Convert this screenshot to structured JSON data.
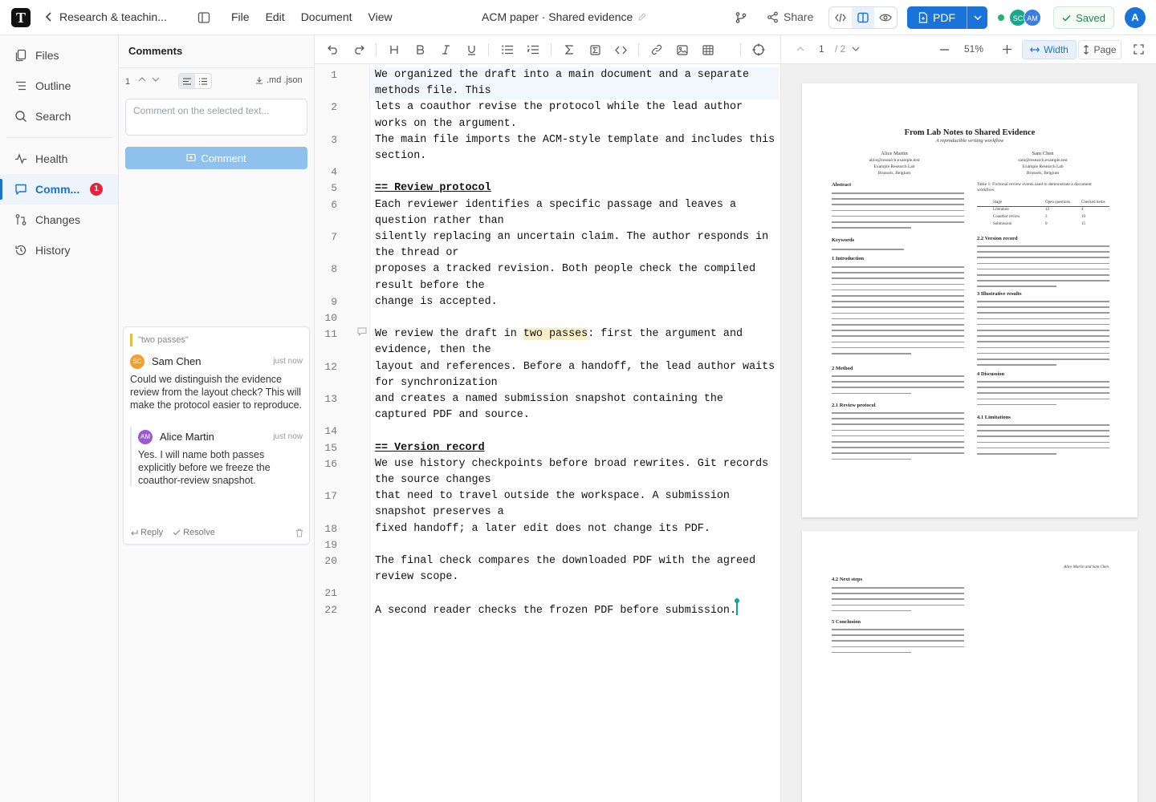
{
  "topbar": {
    "logo": "T",
    "project": "Research & teachin...",
    "menu": [
      "File",
      "Edit",
      "Document",
      "View"
    ],
    "doc_title": "ACM paper · Shared evidence",
    "share": "Share",
    "pdf": "PDF",
    "avatars": [
      {
        "initials": "SC",
        "color": "#1aa88c"
      },
      {
        "initials": "AM",
        "color": "#3b7de0"
      }
    ],
    "saved": "Saved",
    "user": "A"
  },
  "nav": {
    "items": [
      {
        "label": "Files",
        "icon": "files-icon"
      },
      {
        "label": "Outline",
        "icon": "outline-icon"
      },
      {
        "label": "Search",
        "icon": "search-icon"
      },
      {
        "label": "Health",
        "icon": "health-icon"
      },
      {
        "label": "Comm...",
        "icon": "comment-icon",
        "badge": "1"
      },
      {
        "label": "Changes",
        "icon": "changes-icon"
      },
      {
        "label": "History",
        "icon": "history-icon"
      }
    ]
  },
  "comments": {
    "title": "Comments",
    "count": "1",
    "export": ".md .json",
    "placeholder": "Comment on the selected text...",
    "button": "Comment",
    "thread": {
      "quote": "\"two passes\"",
      "entries": [
        {
          "initials": "SC",
          "name": "Sam Chen",
          "time": "just now",
          "color": "#f0a030",
          "text": "Could we distinguish the evidence review from the layout check? This will make the protocol easier to reproduce."
        },
        {
          "initials": "AM",
          "name": "Alice Martin",
          "time": "just now",
          "color": "#9b59d0",
          "text": "Yes. I will name both passes explicitly before we freeze the coauthor-review snapshot."
        }
      ],
      "reply": "Reply",
      "resolve": "Resolve"
    }
  },
  "editor": {
    "lines": [
      {
        "n": "1",
        "parts": [
          {
            "t": "We organized the draft into a main document and a separate\nmethods file. This"
          }
        ]
      },
      {
        "n": "2",
        "parts": [
          {
            "t": "lets a coauthor revise the protocol while the lead author\nworks on the argument."
          }
        ]
      },
      {
        "n": "3",
        "parts": [
          {
            "t": "The main file imports the ACM-style template and includes this\nsection."
          }
        ]
      },
      {
        "n": "4",
        "parts": [
          {
            "t": ""
          }
        ]
      },
      {
        "n": "5",
        "parts": [
          {
            "t": "== Review protocol",
            "c": "hd"
          }
        ]
      },
      {
        "n": "6",
        "parts": [
          {
            "t": "Each reviewer identifies a specific passage and leaves a\nquestion rather than"
          }
        ]
      },
      {
        "n": "7",
        "parts": [
          {
            "t": "silently replacing an uncertain claim. The author responds in\nthe thread or"
          }
        ]
      },
      {
        "n": "8",
        "parts": [
          {
            "t": "proposes a tracked revision. Both people check the compiled\nresult before the"
          }
        ]
      },
      {
        "n": "9",
        "parts": [
          {
            "t": "change is accepted."
          }
        ]
      },
      {
        "n": "10",
        "parts": [
          {
            "t": ""
          }
        ]
      },
      {
        "n": "11",
        "parts": [
          {
            "t": "We review the draft in "
          },
          {
            "t": "two passes",
            "c": "hl"
          },
          {
            "t": ": first the argument and\nevidence, then the"
          }
        ]
      },
      {
        "n": "12",
        "parts": [
          {
            "t": "layout and references. Before a handoff, the lead author waits\nfor synchronization"
          }
        ]
      },
      {
        "n": "13",
        "parts": [
          {
            "t": "and creates a named submission snapshot containing the\ncaptured PDF and source."
          }
        ]
      },
      {
        "n": "14",
        "parts": [
          {
            "t": ""
          }
        ]
      },
      {
        "n": "15",
        "parts": [
          {
            "t": "== Version record",
            "c": "hd"
          }
        ]
      },
      {
        "n": "16",
        "parts": [
          {
            "t": "We use history checkpoints before broad rewrites. Git records\nthe source changes"
          }
        ]
      },
      {
        "n": "17",
        "parts": [
          {
            "t": "that need to travel outside the workspace. A submission\nsnapshot preserves a"
          }
        ]
      },
      {
        "n": "18",
        "parts": [
          {
            "t": "fixed handoff; a later edit does not change its PDF."
          }
        ]
      },
      {
        "n": "19",
        "parts": [
          {
            "t": ""
          }
        ]
      },
      {
        "n": "20",
        "parts": [
          {
            "t": "The final check compares the downloaded PDF with the agreed\nreview scope."
          }
        ]
      },
      {
        "n": "21",
        "parts": [
          {
            "t": ""
          }
        ]
      },
      {
        "n": "22",
        "parts": [
          {
            "t": "A second reader checks the frozen PDF before submission."
          },
          {
            "t": "",
            "c": "caret"
          }
        ]
      }
    ]
  },
  "pdfbar": {
    "page": "1",
    "pages": "/ 2",
    "zoom": "51%",
    "width": "Width",
    "page_fit": "Page"
  },
  "pdf": {
    "title": "From Lab Notes to Shared Evidence",
    "subtitle": "A reproducible writing workflow",
    "authors": [
      {
        "name": "Alice Martin",
        "lines": [
          "alice@research.example.test",
          "Example Research Lab",
          "Brussels, Belgium"
        ]
      },
      {
        "name": "Sam Chen",
        "lines": [
          "sam@research.example.test",
          "Example Research Lab",
          "Brussels, Belgium"
        ]
      }
    ],
    "headings_left": [
      "Abstract",
      "Keywords",
      "1  Introduction",
      "2  Method",
      "2.1  Review protocol"
    ],
    "headings_right": [
      "2.2  Version record",
      "3  Illustrative results",
      "4  Discussion",
      "4.1  Limitations"
    ],
    "table_caption": "Table 1: Fictional review events used to demonstrate a document workflow.",
    "table": [
      [
        "Stage",
        "Open questions",
        "Checked items"
      ],
      [
        "Literature",
        "12",
        "4"
      ],
      [
        "Coauthor review",
        "3",
        "10"
      ],
      [
        "Submission",
        "0",
        "15"
      ]
    ],
    "page2_header": "Alice Martin and Sam Chen",
    "page2_headings": [
      "4.2  Next steps",
      "5  Conclusion"
    ]
  }
}
